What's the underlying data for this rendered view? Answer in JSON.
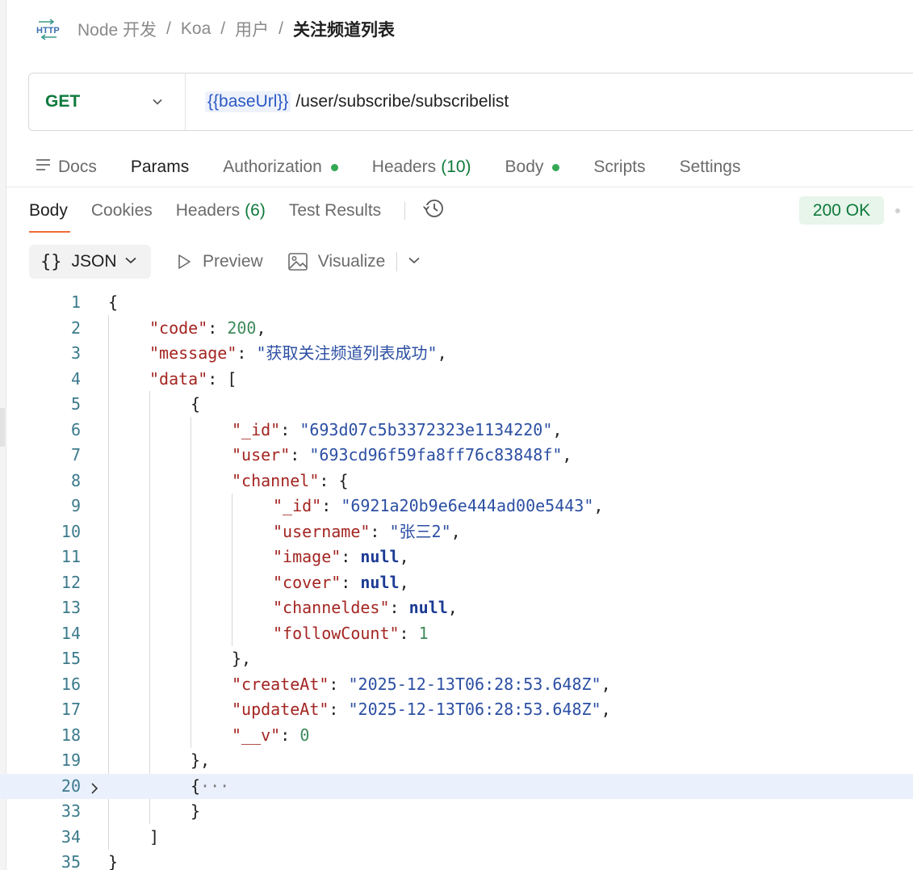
{
  "breadcrumb": {
    "icon": "http-icon",
    "items": [
      "Node 开发",
      "Koa",
      "用户"
    ],
    "current": "关注频道列表"
  },
  "request": {
    "method": "GET",
    "url_variable": "{{baseUrl}}",
    "url_path": "/user/subscribe/subscribelist"
  },
  "request_tabs": {
    "docs": "Docs",
    "params": "Params",
    "authorization": "Authorization",
    "headers": "Headers",
    "headers_count": "(10)",
    "body": "Body",
    "scripts": "Scripts",
    "settings": "Settings"
  },
  "response_tabs": {
    "body": "Body",
    "cookies": "Cookies",
    "headers": "Headers",
    "headers_count": "(6)",
    "test_results": "Test Results"
  },
  "status": "200 OK",
  "toolbar": {
    "format": "JSON",
    "preview": "Preview",
    "visualize": "Visualize"
  },
  "code_lines": [
    {
      "ln": "1",
      "indent": 0,
      "tokens": [
        [
          "p",
          "{"
        ]
      ]
    },
    {
      "ln": "2",
      "indent": 1,
      "tokens": [
        [
          "k",
          "\"code\""
        ],
        [
          "p",
          ": "
        ],
        [
          "n",
          "200"
        ],
        [
          "p",
          ","
        ]
      ]
    },
    {
      "ln": "3",
      "indent": 1,
      "tokens": [
        [
          "k",
          "\"message\""
        ],
        [
          "p",
          ": "
        ],
        [
          "s",
          "\"获取关注频道列表成功\""
        ],
        [
          "p",
          ","
        ]
      ]
    },
    {
      "ln": "4",
      "indent": 1,
      "tokens": [
        [
          "k",
          "\"data\""
        ],
        [
          "p",
          ": ["
        ]
      ]
    },
    {
      "ln": "5",
      "indent": 2,
      "tokens": [
        [
          "p",
          "{"
        ]
      ]
    },
    {
      "ln": "6",
      "indent": 3,
      "tokens": [
        [
          "k",
          "\"_id\""
        ],
        [
          "p",
          ": "
        ],
        [
          "s",
          "\"693d07c5b3372323e1134220\""
        ],
        [
          "p",
          ","
        ]
      ]
    },
    {
      "ln": "7",
      "indent": 3,
      "tokens": [
        [
          "k",
          "\"user\""
        ],
        [
          "p",
          ": "
        ],
        [
          "s",
          "\"693cd96f59fa8ff76c83848f\""
        ],
        [
          "p",
          ","
        ]
      ]
    },
    {
      "ln": "8",
      "indent": 3,
      "tokens": [
        [
          "k",
          "\"channel\""
        ],
        [
          "p",
          ": {"
        ]
      ]
    },
    {
      "ln": "9",
      "indent": 4,
      "tokens": [
        [
          "k",
          "\"_id\""
        ],
        [
          "p",
          ": "
        ],
        [
          "s",
          "\"6921a20b9e6e444ad00e5443\""
        ],
        [
          "p",
          ","
        ]
      ]
    },
    {
      "ln": "10",
      "indent": 4,
      "tokens": [
        [
          "k",
          "\"username\""
        ],
        [
          "p",
          ": "
        ],
        [
          "s",
          "\"张三2\""
        ],
        [
          "p",
          ","
        ]
      ]
    },
    {
      "ln": "11",
      "indent": 4,
      "tokens": [
        [
          "k",
          "\"image\""
        ],
        [
          "p",
          ": "
        ],
        [
          "kw",
          "null"
        ],
        [
          "p",
          ","
        ]
      ]
    },
    {
      "ln": "12",
      "indent": 4,
      "tokens": [
        [
          "k",
          "\"cover\""
        ],
        [
          "p",
          ": "
        ],
        [
          "kw",
          "null"
        ],
        [
          "p",
          ","
        ]
      ]
    },
    {
      "ln": "13",
      "indent": 4,
      "tokens": [
        [
          "k",
          "\"channeldes\""
        ],
        [
          "p",
          ": "
        ],
        [
          "kw",
          "null"
        ],
        [
          "p",
          ","
        ]
      ]
    },
    {
      "ln": "14",
      "indent": 4,
      "tokens": [
        [
          "k",
          "\"followCount\""
        ],
        [
          "p",
          ": "
        ],
        [
          "n",
          "1"
        ]
      ]
    },
    {
      "ln": "15",
      "indent": 3,
      "tokens": [
        [
          "p",
          "},"
        ]
      ]
    },
    {
      "ln": "16",
      "indent": 3,
      "tokens": [
        [
          "k",
          "\"createAt\""
        ],
        [
          "p",
          ": "
        ],
        [
          "s",
          "\"2025-12-13T06:28:53.648Z\""
        ],
        [
          "p",
          ","
        ]
      ]
    },
    {
      "ln": "17",
      "indent": 3,
      "tokens": [
        [
          "k",
          "\"updateAt\""
        ],
        [
          "p",
          ": "
        ],
        [
          "s",
          "\"2025-12-13T06:28:53.648Z\""
        ],
        [
          "p",
          ","
        ]
      ]
    },
    {
      "ln": "18",
      "indent": 3,
      "tokens": [
        [
          "k",
          "\"__v\""
        ],
        [
          "p",
          ": "
        ],
        [
          "n",
          "0"
        ]
      ]
    },
    {
      "ln": "19",
      "indent": 2,
      "tokens": [
        [
          "p",
          "},"
        ]
      ]
    },
    {
      "ln": "20",
      "indent": 2,
      "fold": true,
      "highlight": true,
      "tokens": [
        [
          "p",
          "{"
        ],
        [
          "ell",
          "···"
        ]
      ]
    },
    {
      "ln": "33",
      "indent": 2,
      "tokens": [
        [
          "p",
          "}"
        ]
      ]
    },
    {
      "ln": "34",
      "indent": 1,
      "tokens": [
        [
          "p",
          "]"
        ]
      ]
    },
    {
      "ln": "35",
      "indent": 0,
      "tokens": [
        [
          "p",
          "}"
        ]
      ]
    }
  ],
  "colors": {
    "method": "#0e7a3c",
    "status_bg": "#e7f5ea",
    "active_underline": "#f26b3a",
    "json_key": "#a32521",
    "json_string": "#2c4fa3",
    "json_number": "#3e8a5b"
  }
}
